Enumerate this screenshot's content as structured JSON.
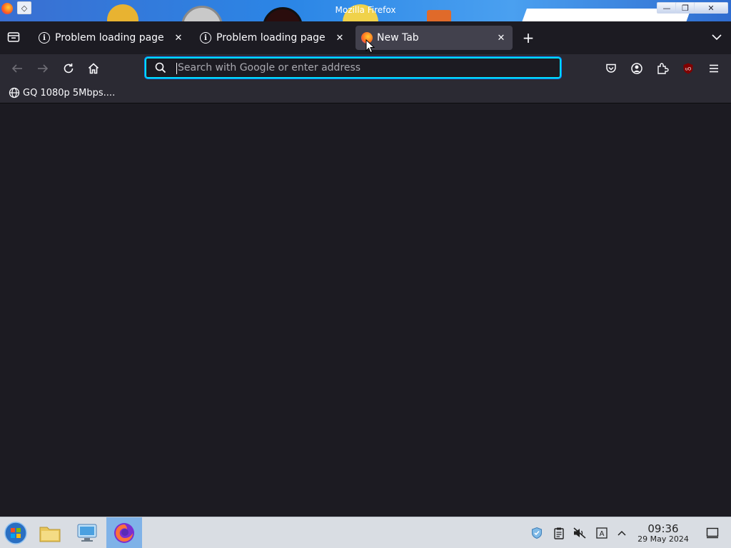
{
  "window": {
    "title": "Mozilla Firefox",
    "controls": {
      "minimize": "—",
      "restore": "❐",
      "close": "✕"
    }
  },
  "tabs": [
    {
      "label": "Problem loading page",
      "icon": "info-icon",
      "active": false
    },
    {
      "label": "Problem loading page",
      "icon": "info-icon",
      "active": false
    },
    {
      "label": "New Tab",
      "icon": "firefox-icon",
      "active": true
    }
  ],
  "tab_close_glyph": "✕",
  "new_tab_glyph": "+",
  "urlbar": {
    "placeholder": "Search with Google or enter address",
    "value": ""
  },
  "toolbar_icons": [
    "pocket-icon",
    "account-icon",
    "extensions-icon",
    "ublock-icon",
    "menu-icon"
  ],
  "bookmarks": [
    {
      "label": "GQ 1080p 5Mbps....",
      "icon": "globe-icon"
    }
  ],
  "taskbar": {
    "apps": [
      "start-icon",
      "file-manager-icon",
      "control-panel-icon",
      "firefox-icon"
    ],
    "active_app": "firefox-icon",
    "tray_icons": [
      "update-icon",
      "clipboard-icon",
      "volume-muted-icon",
      "keyboard-layout-icon",
      "show-hidden-icon"
    ],
    "clock": {
      "time": "09:36",
      "date": "29 May 2024"
    }
  },
  "colors": {
    "titlebar": "#2b86e6",
    "tabstrip": "#1c1b22",
    "navbar": "#2b2a33",
    "active_tab": "#42414d",
    "urlbar_focus": "#00ddff",
    "content": "#1c1b22",
    "taskbar": "#d9dde3",
    "ublock": "#800000"
  }
}
